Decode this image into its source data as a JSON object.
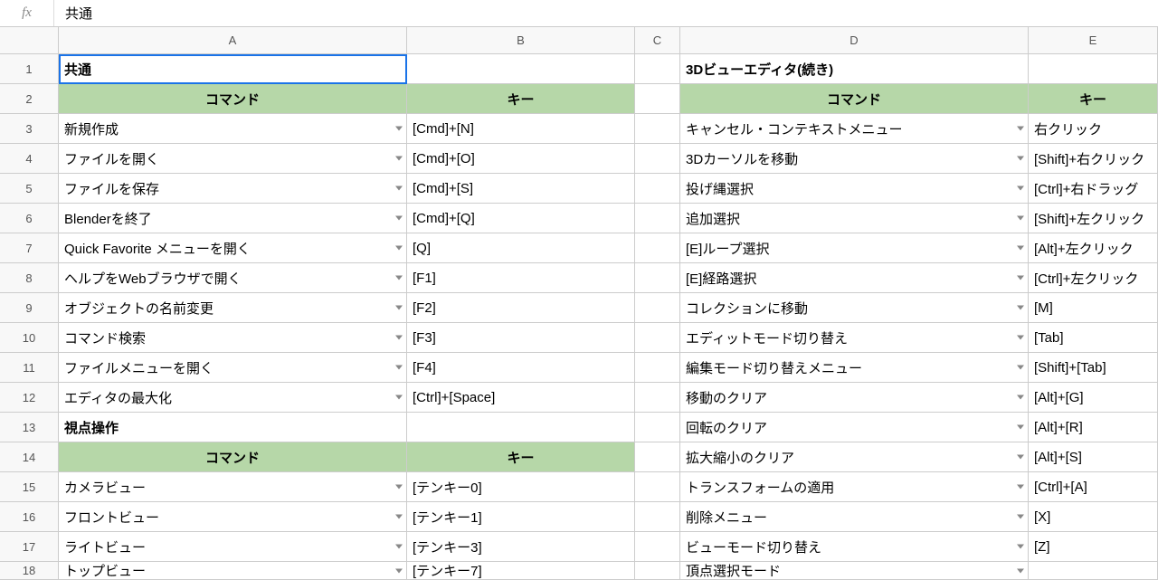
{
  "formula_bar": {
    "fx_label": "fx",
    "value": "共通"
  },
  "columns": [
    "A",
    "B",
    "C",
    "D",
    "E"
  ],
  "row_numbers": [
    "1",
    "2",
    "3",
    "4",
    "5",
    "6",
    "7",
    "8",
    "9",
    "10",
    "11",
    "12",
    "13",
    "14",
    "15",
    "16",
    "17",
    "18"
  ],
  "cells": {
    "A1": "共通",
    "D1": "3Dビューエディタ(続き)",
    "A2": "コマンド",
    "B2": "キー",
    "D2": "コマンド",
    "E2": "キー",
    "A3": "新規作成",
    "B3": "[Cmd]+[N]",
    "D3": "キャンセル・コンテキストメニュー",
    "E3": "右クリック",
    "A4": "ファイルを開く",
    "B4": "[Cmd]+[O]",
    "D4": "3Dカーソルを移動",
    "E4": "[Shift]+右クリック",
    "A5": "ファイルを保存",
    "B5": "[Cmd]+[S]",
    "D5": "投げ縄選択",
    "E5": "[Ctrl]+右ドラッグ",
    "A6": "Blenderを終了",
    "B6": "[Cmd]+[Q]",
    "D6": "追加選択",
    "E6": "[Shift]+左クリック",
    "A7": "Quick Favorite メニューを開く",
    "B7": "[Q]",
    "D7": "[E]ループ選択",
    "E7": "[Alt]+左クリック",
    "A8": "ヘルプをWebブラウザで開く",
    "B8": "[F1]",
    "D8": "[E]経路選択",
    "E8": "[Ctrl]+左クリック",
    "A9": "オブジェクトの名前変更",
    "B9": "[F2]",
    "D9": "コレクションに移動",
    "E9": "[M]",
    "A10": "コマンド検索",
    "B10": "[F3]",
    "D10": "エディットモード切り替え",
    "E10": "[Tab]",
    "A11": "ファイルメニューを開く",
    "B11": "[F4]",
    "D11": "編集モード切り替えメニュー",
    "E11": "[Shift]+[Tab]",
    "A12": "エディタの最大化",
    "B12": "[Ctrl]+[Space]",
    "D12": "移動のクリア",
    "E12": "[Alt]+[G]",
    "A13": "視点操作",
    "D13": "回転のクリア",
    "E13": "[Alt]+[R]",
    "A14": "コマンド",
    "B14": "キー",
    "D14": "拡大縮小のクリア",
    "E14": "[Alt]+[S]",
    "A15": "カメラビュー",
    "B15": "[テンキー0]",
    "D15": "トランスフォームの適用",
    "E15": "[Ctrl]+[A]",
    "A16": "フロントビュー",
    "B16": "[テンキー1]",
    "D16": "削除メニュー",
    "E16": "[X]",
    "A17": "ライトビュー",
    "B17": "[テンキー3]",
    "D17": "ビューモード切り替え",
    "E17": "[Z]",
    "A18": "トップビュー",
    "B18": "[テンキー7]",
    "D18": "頂点選択モード",
    "E18": ""
  }
}
